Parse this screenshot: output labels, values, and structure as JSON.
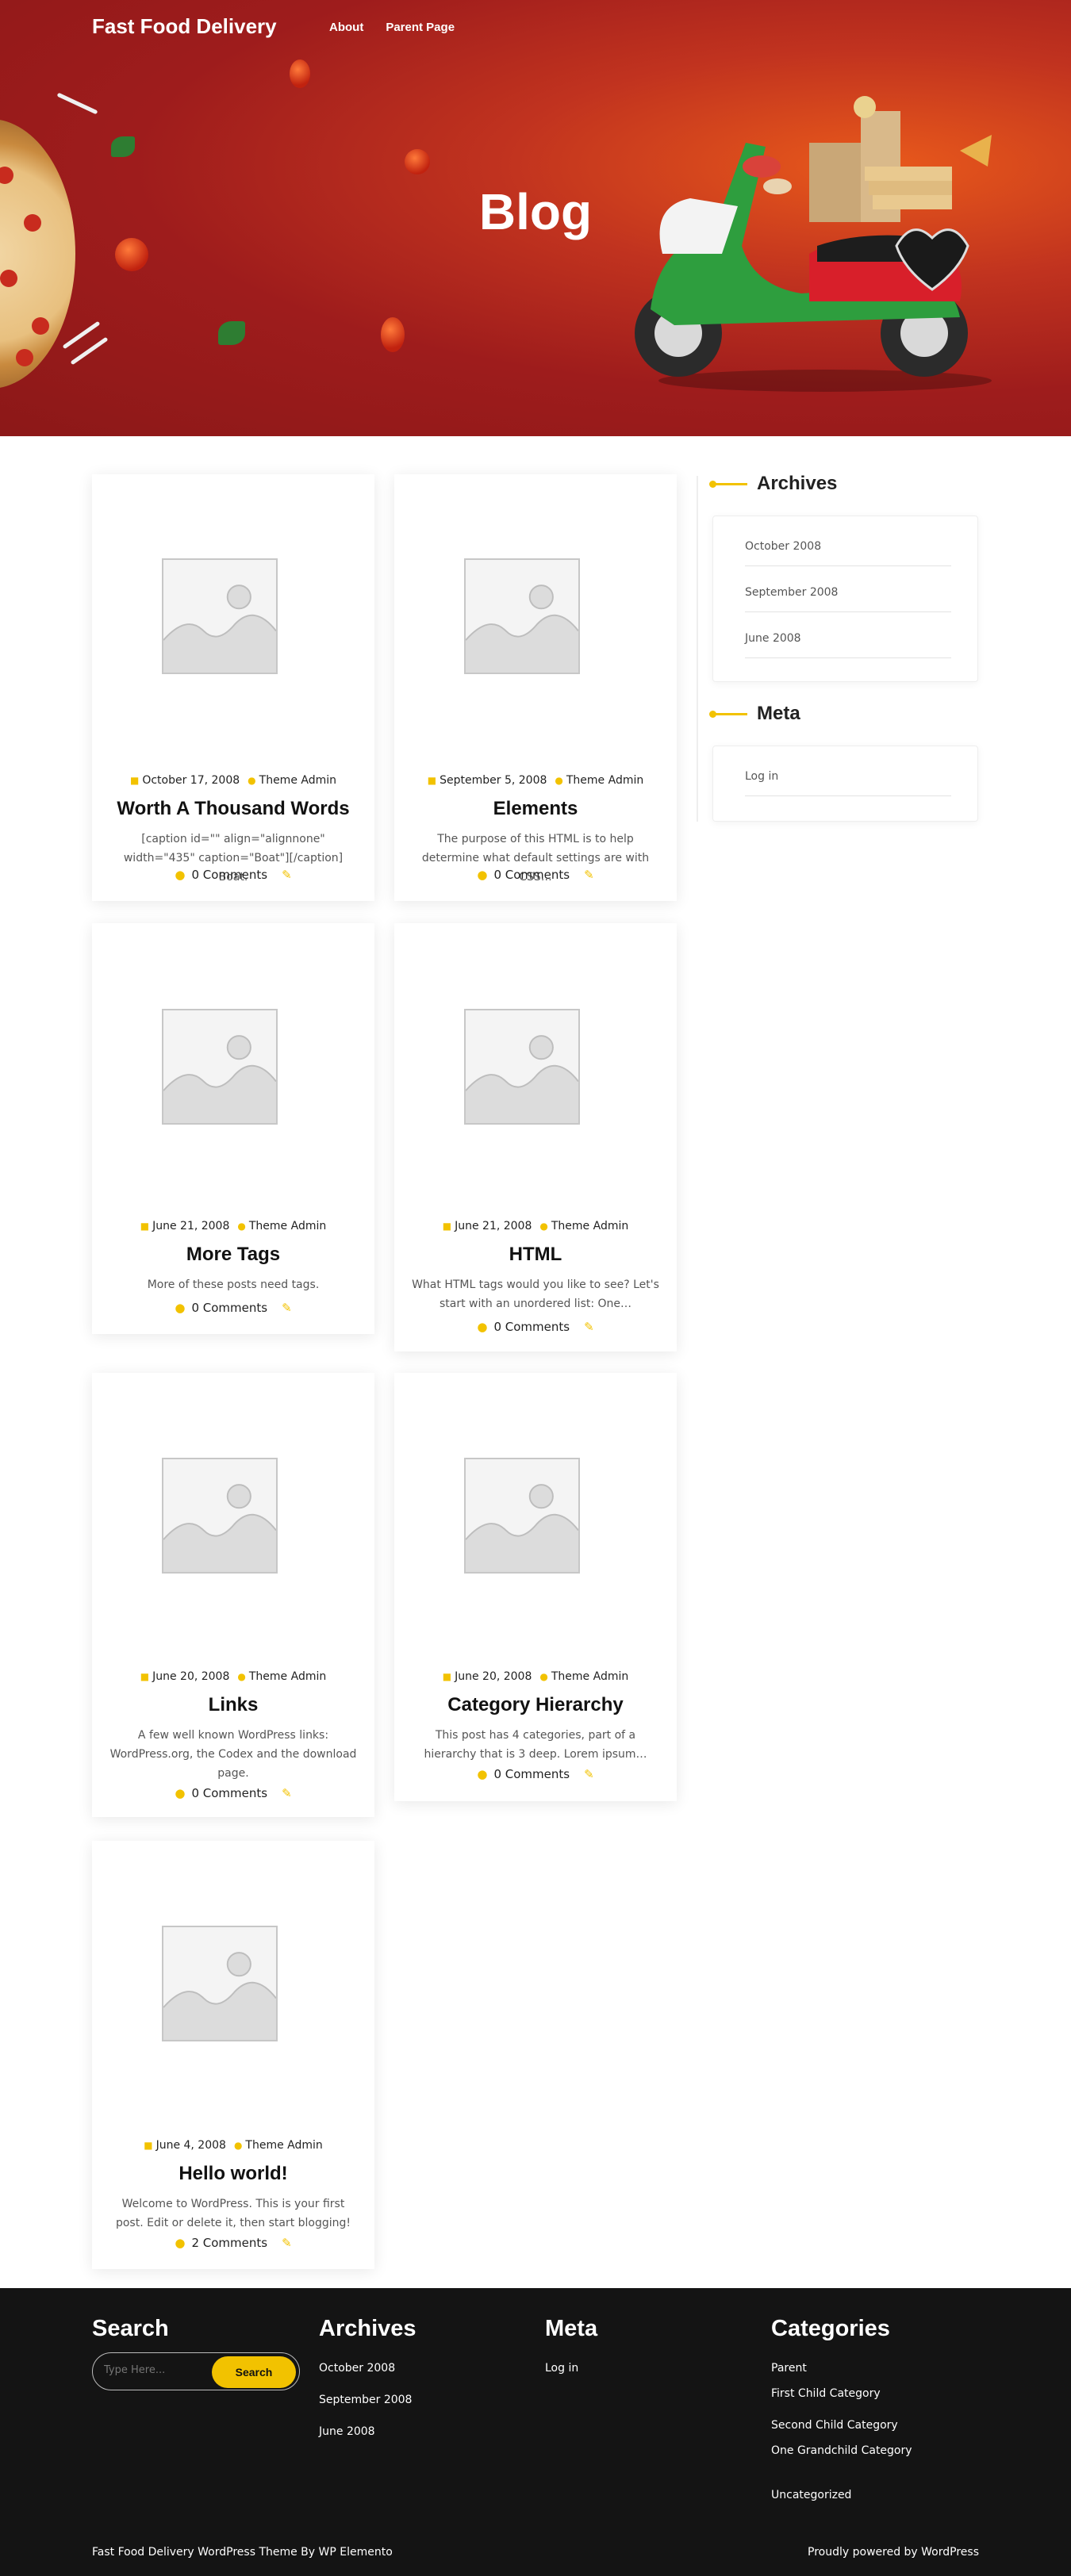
{
  "header": {
    "site_title": "Fast Food Delivery",
    "nav": [
      "About",
      "Parent Page"
    ],
    "hero_title": "Blog"
  },
  "colors": {
    "accent": "#f2c200",
    "hero_bg": "#9e1c1c",
    "footer_bg": "#141414"
  },
  "icons": {
    "date": "calendar-icon",
    "author": "user-icon",
    "comments": "comments-icon",
    "edit": "edit-icon",
    "thumbnail": "image-placeholder-icon"
  },
  "posts": [
    {
      "date": "October 17, 2008",
      "author": "Theme Admin",
      "title": "Worth A Thousand Words",
      "excerpt": "[caption id=\"\" align=\"alignnone\" width=\"435\" caption=\"Boat\"][/caption] Boat.",
      "comments": "0 Comments"
    },
    {
      "date": "September 5, 2008",
      "author": "Theme Admin",
      "title": "Elements",
      "excerpt": "The purpose of this HTML is to help determine what default settings are with CSS…",
      "comments": "0 Comments"
    },
    {
      "date": "June 21, 2008",
      "author": "Theme Admin",
      "title": "More Tags",
      "excerpt": "More of these posts need tags.",
      "comments": "0 Comments"
    },
    {
      "date": "June 21, 2008",
      "author": "Theme Admin",
      "title": "HTML",
      "excerpt": "What HTML tags would you like to see? Let's start with an unordered list: One…",
      "comments": "0 Comments"
    },
    {
      "date": "June 20, 2008",
      "author": "Theme Admin",
      "title": "Links",
      "excerpt": "A few well known WordPress links: WordPress.org, the Codex and the download page.",
      "comments": "0 Comments"
    },
    {
      "date": "June 20, 2008",
      "author": "Theme Admin",
      "title": "Category Hierarchy",
      "excerpt": "This post has 4 categories, part of a hierarchy that is 3 deep. Lorem ipsum…",
      "comments": "0 Comments"
    },
    {
      "date": "June 4, 2008",
      "author": "Theme Admin",
      "title": "Hello world!",
      "excerpt": "Welcome to WordPress. This is your first post. Edit or delete it, then start blogging!",
      "comments": "2 Comments"
    }
  ],
  "sidebar": {
    "archives_title": "Archives",
    "archives": [
      "October 2008",
      "September 2008",
      "June 2008"
    ],
    "meta_title": "Meta",
    "meta": [
      "Log in"
    ]
  },
  "footer": {
    "search_title": "Search",
    "search_placeholder": "Type Here...",
    "search_button": "Search",
    "archives_title": "Archives",
    "archives": [
      "October 2008",
      "September 2008",
      "June 2008"
    ],
    "meta_title": "Meta",
    "meta": [
      "Log in"
    ],
    "categories_title": "Categories",
    "categories": [
      "Parent",
      "First Child Category",
      "Second Child Category",
      "One Grandchild Category",
      "Uncategorized"
    ],
    "credits_left": "Fast Food Delivery WordPress Theme By WP Elemento",
    "credits_right": "Proudly powered by WordPress"
  }
}
